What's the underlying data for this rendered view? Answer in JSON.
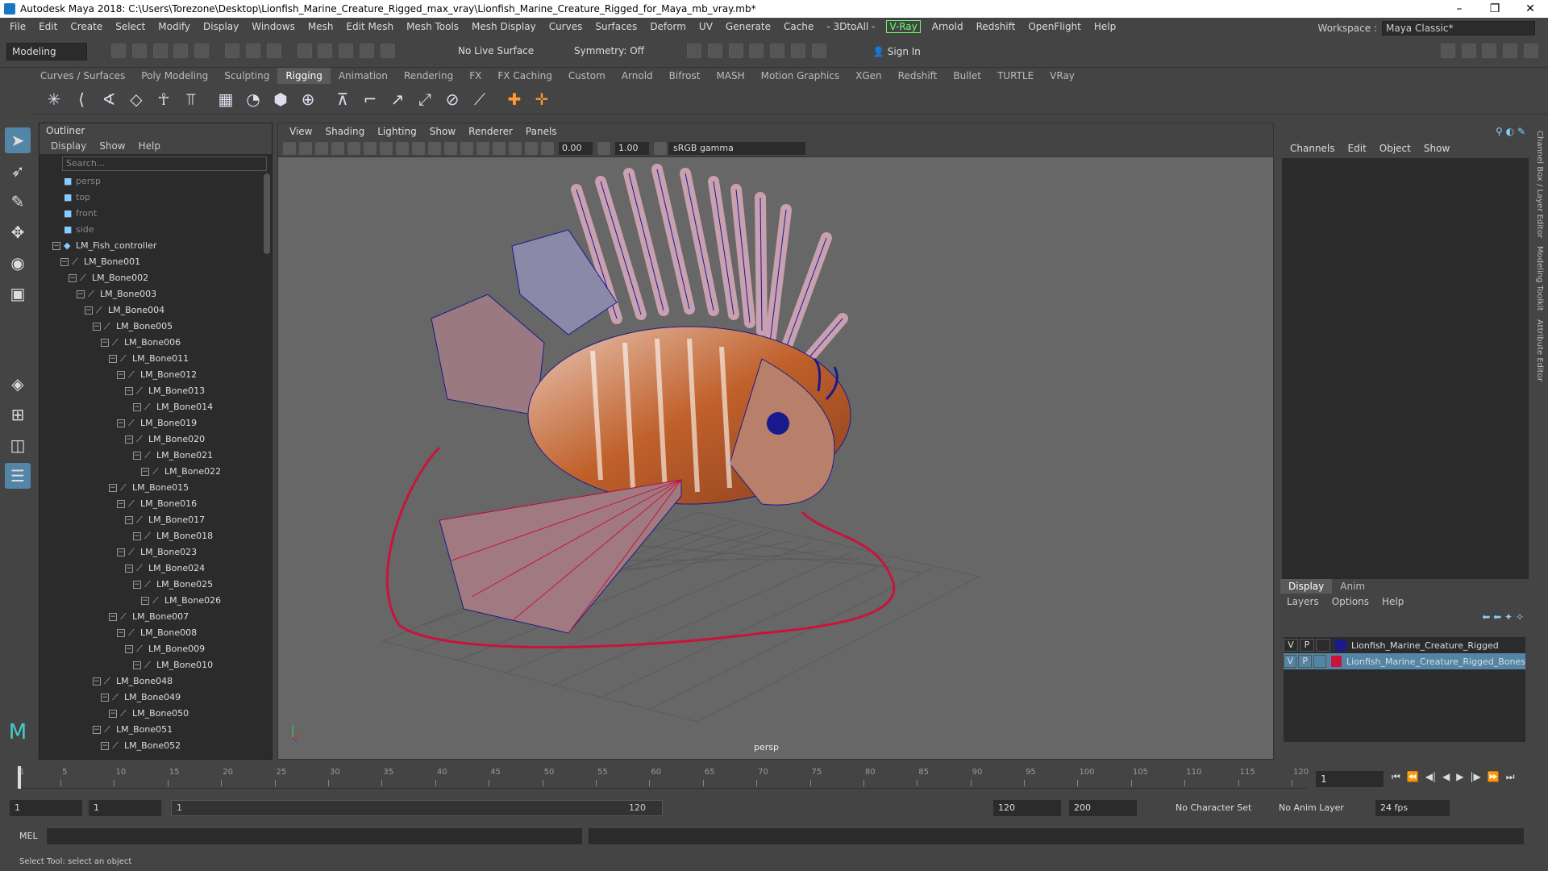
{
  "window": {
    "title": "Autodesk Maya 2018: C:\\Users\\Torezone\\Desktop\\Lionfish_Marine_Creature_Rigged_max_vray\\Lionfish_Marine_Creature_Rigged_for_Maya_mb_vray.mb*"
  },
  "menu": [
    "File",
    "Edit",
    "Create",
    "Select",
    "Modify",
    "Display",
    "Windows",
    "Mesh",
    "Edit Mesh",
    "Mesh Tools",
    "Mesh Display",
    "Curves",
    "Surfaces",
    "Deform",
    "UV",
    "Generate",
    "Cache",
    "- 3DtoAll -",
    "V-Ray",
    "Arnold",
    "Redshift",
    "OpenFlight",
    "Help"
  ],
  "workspace": {
    "label": "Workspace :",
    "value": "Maya Classic*"
  },
  "status": {
    "mode": "Modeling",
    "live_surface": "No Live Surface",
    "symmetry": "Symmetry: Off",
    "sign_in": "Sign In"
  },
  "shelf_tabs": [
    "Curves / Surfaces",
    "Poly Modeling",
    "Sculpting",
    "Rigging",
    "Animation",
    "Rendering",
    "FX",
    "FX Caching",
    "Custom",
    "Arnold",
    "Bifrost",
    "MASH",
    "Motion Graphics",
    "XGen",
    "Redshift",
    "Bullet",
    "TURTLE",
    "VRay"
  ],
  "active_shelf": "Rigging",
  "outliner": {
    "title": "Outliner",
    "menu": [
      "Display",
      "Show",
      "Help"
    ],
    "search_placeholder": "Search...",
    "cameras": [
      "persp",
      "top",
      "front",
      "side"
    ],
    "items": [
      {
        "name": "LM_Fish_controller",
        "depth": 0
      },
      {
        "name": "LM_Bone001",
        "depth": 1
      },
      {
        "name": "LM_Bone002",
        "depth": 2
      },
      {
        "name": "LM_Bone003",
        "depth": 3
      },
      {
        "name": "LM_Bone004",
        "depth": 4
      },
      {
        "name": "LM_Bone005",
        "depth": 5
      },
      {
        "name": "LM_Bone006",
        "depth": 6
      },
      {
        "name": "LM_Bone011",
        "depth": 7
      },
      {
        "name": "LM_Bone012",
        "depth": 8
      },
      {
        "name": "LM_Bone013",
        "depth": 9
      },
      {
        "name": "LM_Bone014",
        "depth": 10
      },
      {
        "name": "LM_Bone019",
        "depth": 8
      },
      {
        "name": "LM_Bone020",
        "depth": 9
      },
      {
        "name": "LM_Bone021",
        "depth": 10
      },
      {
        "name": "LM_Bone022",
        "depth": 11
      },
      {
        "name": "LM_Bone015",
        "depth": 7
      },
      {
        "name": "LM_Bone016",
        "depth": 8
      },
      {
        "name": "LM_Bone017",
        "depth": 9
      },
      {
        "name": "LM_Bone018",
        "depth": 10
      },
      {
        "name": "LM_Bone023",
        "depth": 8
      },
      {
        "name": "LM_Bone024",
        "depth": 9
      },
      {
        "name": "LM_Bone025",
        "depth": 10
      },
      {
        "name": "LM_Bone026",
        "depth": 11
      },
      {
        "name": "LM_Bone007",
        "depth": 7
      },
      {
        "name": "LM_Bone008",
        "depth": 8
      },
      {
        "name": "LM_Bone009",
        "depth": 9
      },
      {
        "name": "LM_Bone010",
        "depth": 10
      },
      {
        "name": "LM_Bone048",
        "depth": 5
      },
      {
        "name": "LM_Bone049",
        "depth": 6
      },
      {
        "name": "LM_Bone050",
        "depth": 7
      },
      {
        "name": "LM_Bone051",
        "depth": 5
      },
      {
        "name": "LM_Bone052",
        "depth": 6
      }
    ]
  },
  "viewport": {
    "menu": [
      "View",
      "Shading",
      "Lighting",
      "Show",
      "Renderer",
      "Panels"
    ],
    "exposure": "0.00",
    "gamma": "1.00",
    "colorspace": "sRGB gamma",
    "camera": "persp"
  },
  "channelbox": {
    "menu": [
      "Channels",
      "Edit",
      "Object",
      "Show"
    ]
  },
  "layers": {
    "tabs": [
      "Display",
      "Anim"
    ],
    "menu": [
      "Layers",
      "Options",
      "Help"
    ],
    "rows": [
      {
        "v": "V",
        "p": "P",
        "name": "Lionfish_Marine_Creature_Rigged",
        "color": "#1a1a8c",
        "selected": false
      },
      {
        "v": "V",
        "p": "P",
        "name": "Lionfish_Marine_Creature_Rigged_Bones",
        "color": "#c8143c",
        "selected": true
      }
    ]
  },
  "side_tabs": [
    "Channel Box / Layer Editor",
    "Modeling Toolkit",
    "Attribute Editor"
  ],
  "timeline": {
    "ticks": [
      "1",
      "5",
      "10",
      "15",
      "20",
      "25",
      "30",
      "35",
      "40",
      "45",
      "50",
      "55",
      "60",
      "65",
      "70",
      "75",
      "80",
      "85",
      "90",
      "95",
      "100",
      "105",
      "110",
      "115",
      "120"
    ],
    "current": "1"
  },
  "range": {
    "start": "1",
    "inner_start": "1",
    "slider_start": "1",
    "slider_end": "120",
    "end": "120",
    "max": "200",
    "char_set": "No Character Set",
    "anim_layer": "No Anim Layer",
    "fps": "24 fps"
  },
  "cmd": {
    "label": "MEL"
  },
  "help": "Select Tool: select an object"
}
